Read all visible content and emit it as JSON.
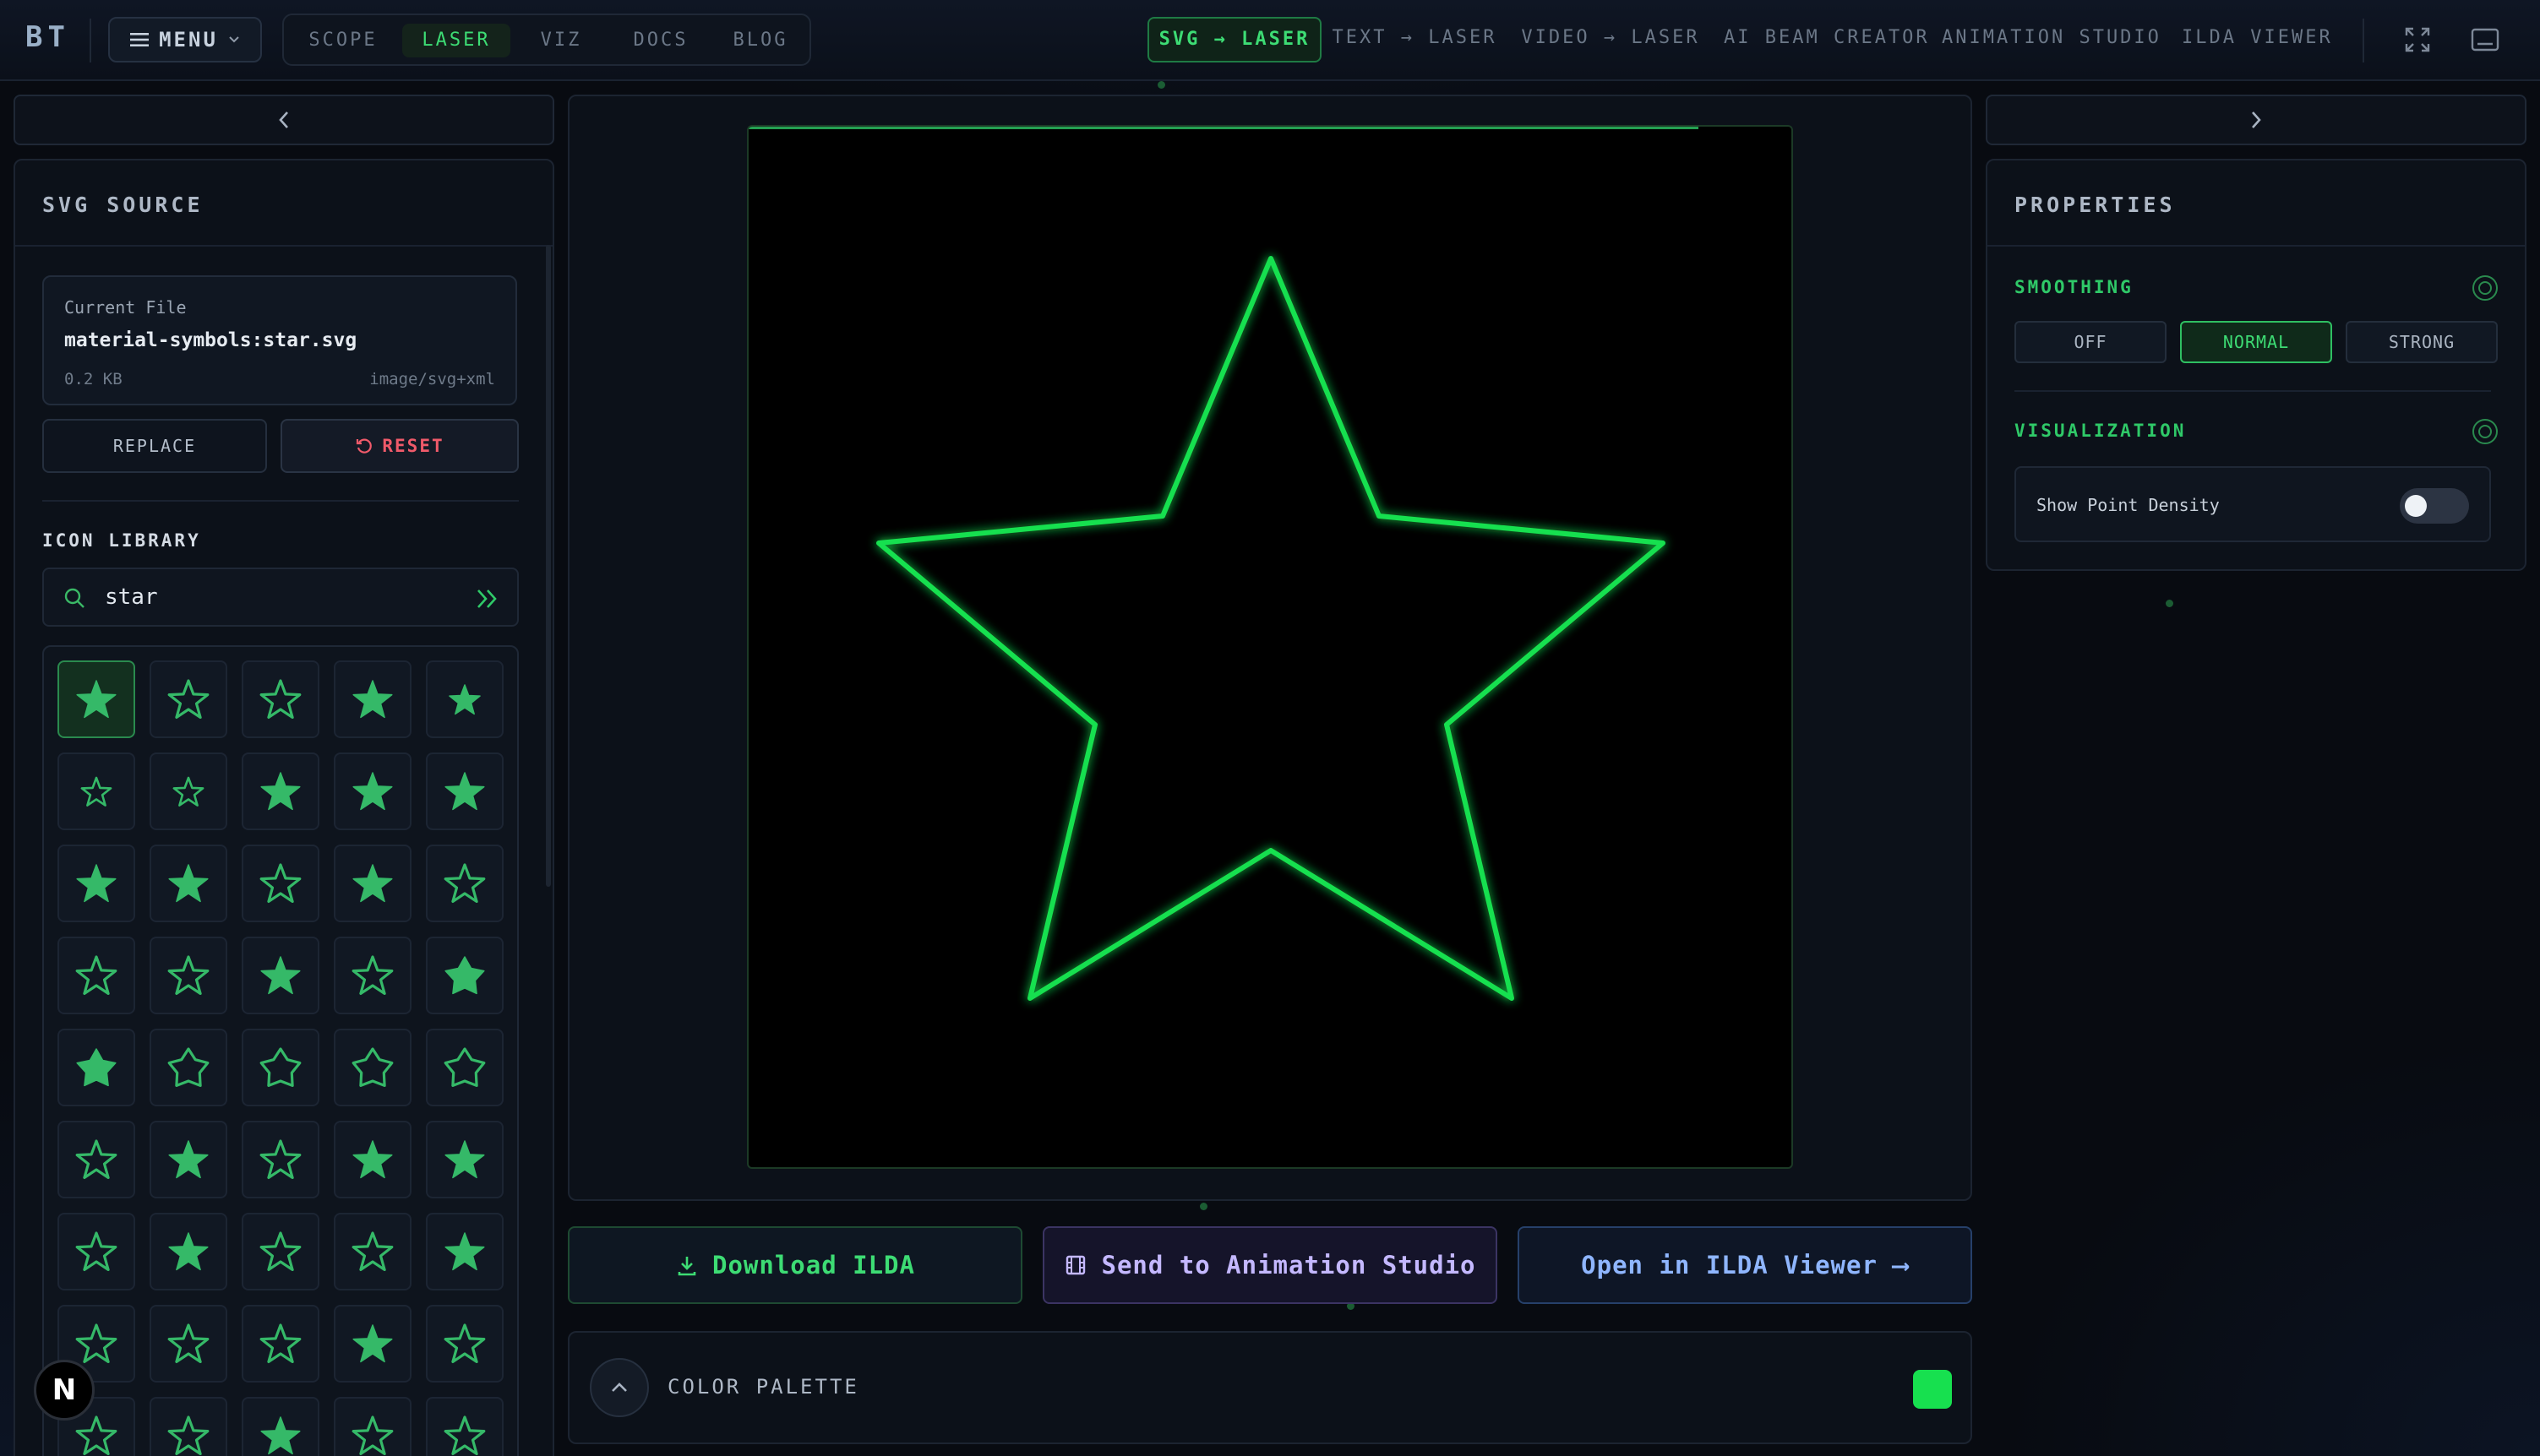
{
  "topbar": {
    "logo": "BT",
    "menu_label": "MENU",
    "nav_tabs": [
      {
        "label": "SCOPE",
        "active": false
      },
      {
        "label": "LASER",
        "active": true
      },
      {
        "label": "VIZ",
        "active": false
      },
      {
        "label": "DOCS",
        "active": false
      },
      {
        "label": "BLOG",
        "active": false
      }
    ],
    "tool_tabs": [
      {
        "label": "SVG → LASER",
        "active": true
      },
      {
        "label": "TEXT → LASER",
        "active": false
      },
      {
        "label": "VIDEO → LASER",
        "active": false
      },
      {
        "label": "AI BEAM CREATOR",
        "active": false
      },
      {
        "label": "ANIMATION STUDIO",
        "active": false
      },
      {
        "label": "ILDA VIEWER",
        "active": false
      }
    ],
    "icons": [
      "fullscreen-icon",
      "panel-icon"
    ]
  },
  "left_panel": {
    "title": "SVG SOURCE",
    "file": {
      "label": "Current File",
      "name": "material-symbols:star.svg",
      "size": "0.2 KB",
      "type": "image/svg+xml"
    },
    "replace_label": "REPLACE",
    "reset_label": "RESET",
    "library_title": "ICON LIBRARY",
    "search_value": "star",
    "selected_index": 0
  },
  "canvas": {
    "beam_color": "#17e04f"
  },
  "actions": {
    "download_label": "Download ILDA",
    "animation_label": "Send to Animation Studio",
    "ilda_label": "Open in ILDA Viewer ⟶"
  },
  "palette": {
    "label": "COLOR PALETTE",
    "swatch_color": "#17e04f"
  },
  "right_panel": {
    "title": "PROPERTIES",
    "smoothing": {
      "title": "SMOOTHING",
      "options": [
        "OFF",
        "NORMAL",
        "STRONG"
      ],
      "selected": "NORMAL"
    },
    "visualization": {
      "title": "VISUALIZATION",
      "toggle_label": "Show Point Density",
      "toggle_on": false
    }
  },
  "badge": "N"
}
